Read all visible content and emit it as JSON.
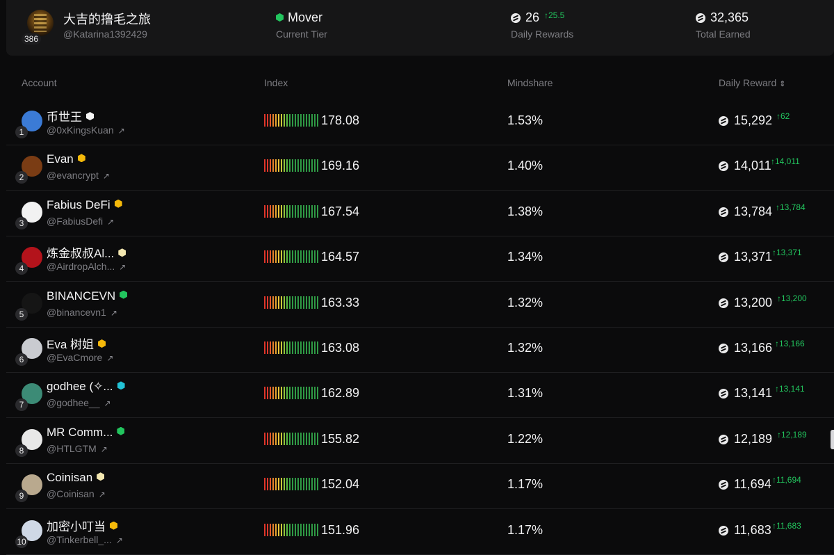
{
  "profile": {
    "name": "大吉的撸毛之旅",
    "handle": "@Katarina1392429",
    "level": "386",
    "tier": "Mover",
    "tier_label": "Current Tier",
    "daily_rewards": "26",
    "daily_rewards_delta": "↑25.5",
    "daily_rewards_label": "Daily Rewards",
    "total_earned": "32,365",
    "total_earned_label": "Total Earned"
  },
  "table": {
    "headers": {
      "account": "Account",
      "index": "Index",
      "mindshare": "Mindshare",
      "daily_reward": "Daily Reward",
      "sort_icon": "⇕"
    },
    "ext_icon": "↗",
    "rows": [
      {
        "rank": "1",
        "name": "币世王",
        "handle": "@0xKingsKuan",
        "index": "178.08",
        "mindshare": "1.53%",
        "reward": "15,292",
        "delta": "↑62",
        "badge_color": "#f5f5f5",
        "avatar_color": "#3b7bd6"
      },
      {
        "rank": "2",
        "name": "Evan",
        "handle": "@evancrypt",
        "index": "169.16",
        "mindshare": "1.40%",
        "reward": "14,011",
        "delta": "↑14,011",
        "badge_color": "#f5b90a",
        "avatar_color": "#7a3c14"
      },
      {
        "rank": "3",
        "name": "Fabius DeFi",
        "handle": "@FabiusDefi",
        "index": "167.54",
        "mindshare": "1.38%",
        "reward": "13,784",
        "delta": "↑13,784",
        "badge_color": "#f5b90a",
        "avatar_color": "#f2f2f2"
      },
      {
        "rank": "4",
        "name": "炼金叔叔Al...",
        "handle": "@AirdropAlch...",
        "index": "164.57",
        "mindshare": "1.34%",
        "reward": "13,371",
        "delta": "↑13,371",
        "badge_color": "#f3e7b0",
        "avatar_color": "#b3131b"
      },
      {
        "rank": "5",
        "name": "BINANCEVN",
        "handle": "@binancevn1",
        "index": "163.33",
        "mindshare": "1.32%",
        "reward": "13,200",
        "delta": "↑13,200",
        "badge_color": "#22c55e",
        "avatar_color": "#151515"
      },
      {
        "rank": "6",
        "name": "Eva 树姐",
        "handle": "@EvaCmore",
        "index": "163.08",
        "mindshare": "1.32%",
        "reward": "13,166",
        "delta": "↑13,166",
        "badge_color": "#f5b90a",
        "avatar_color": "#c9cbd0"
      },
      {
        "rank": "7",
        "name": "godhee (✧...",
        "handle": "@godhee__",
        "index": "162.89",
        "mindshare": "1.31%",
        "reward": "13,141",
        "delta": "↑13,141",
        "badge_color": "#22c3d6",
        "avatar_color": "#3c8b76"
      },
      {
        "rank": "8",
        "name": "MR Comm...",
        "handle": "@HTLGTM",
        "index": "155.82",
        "mindshare": "1.22%",
        "reward": "12,189",
        "delta": "↑12,189",
        "badge_color": "#22c55e",
        "avatar_color": "#e8e8e8"
      },
      {
        "rank": "9",
        "name": "Coinisan",
        "handle": "@Coinisan",
        "index": "152.04",
        "mindshare": "1.17%",
        "reward": "11,694",
        "delta": "↑11,694",
        "badge_color": "#f3e7b0",
        "avatar_color": "#b9a98e"
      },
      {
        "rank": "10",
        "name": "加密小叮当",
        "handle": "@Tinkerbell_...",
        "index": "151.96",
        "mindshare": "1.17%",
        "reward": "11,683",
        "delta": "↑11,683",
        "badge_color": "#f5b90a",
        "avatar_color": "#cfd8e6"
      }
    ]
  },
  "colors": {
    "positive": "#22c55e",
    "index_gradient": [
      "#e0362b",
      "#e0362b",
      "#e25a2b",
      "#e5812c",
      "#e8a42f",
      "#e9c43a",
      "#c8cc3b",
      "#8fc43c",
      "#5bb942",
      "#3aa646",
      "#2f9a45",
      "#2f9a45",
      "#2f9a45",
      "#2f9a45",
      "#2f9a45",
      "#2f9a45",
      "#2f9a45",
      "#2f9a45",
      "#2f9a45",
      "#2f9a45"
    ]
  }
}
